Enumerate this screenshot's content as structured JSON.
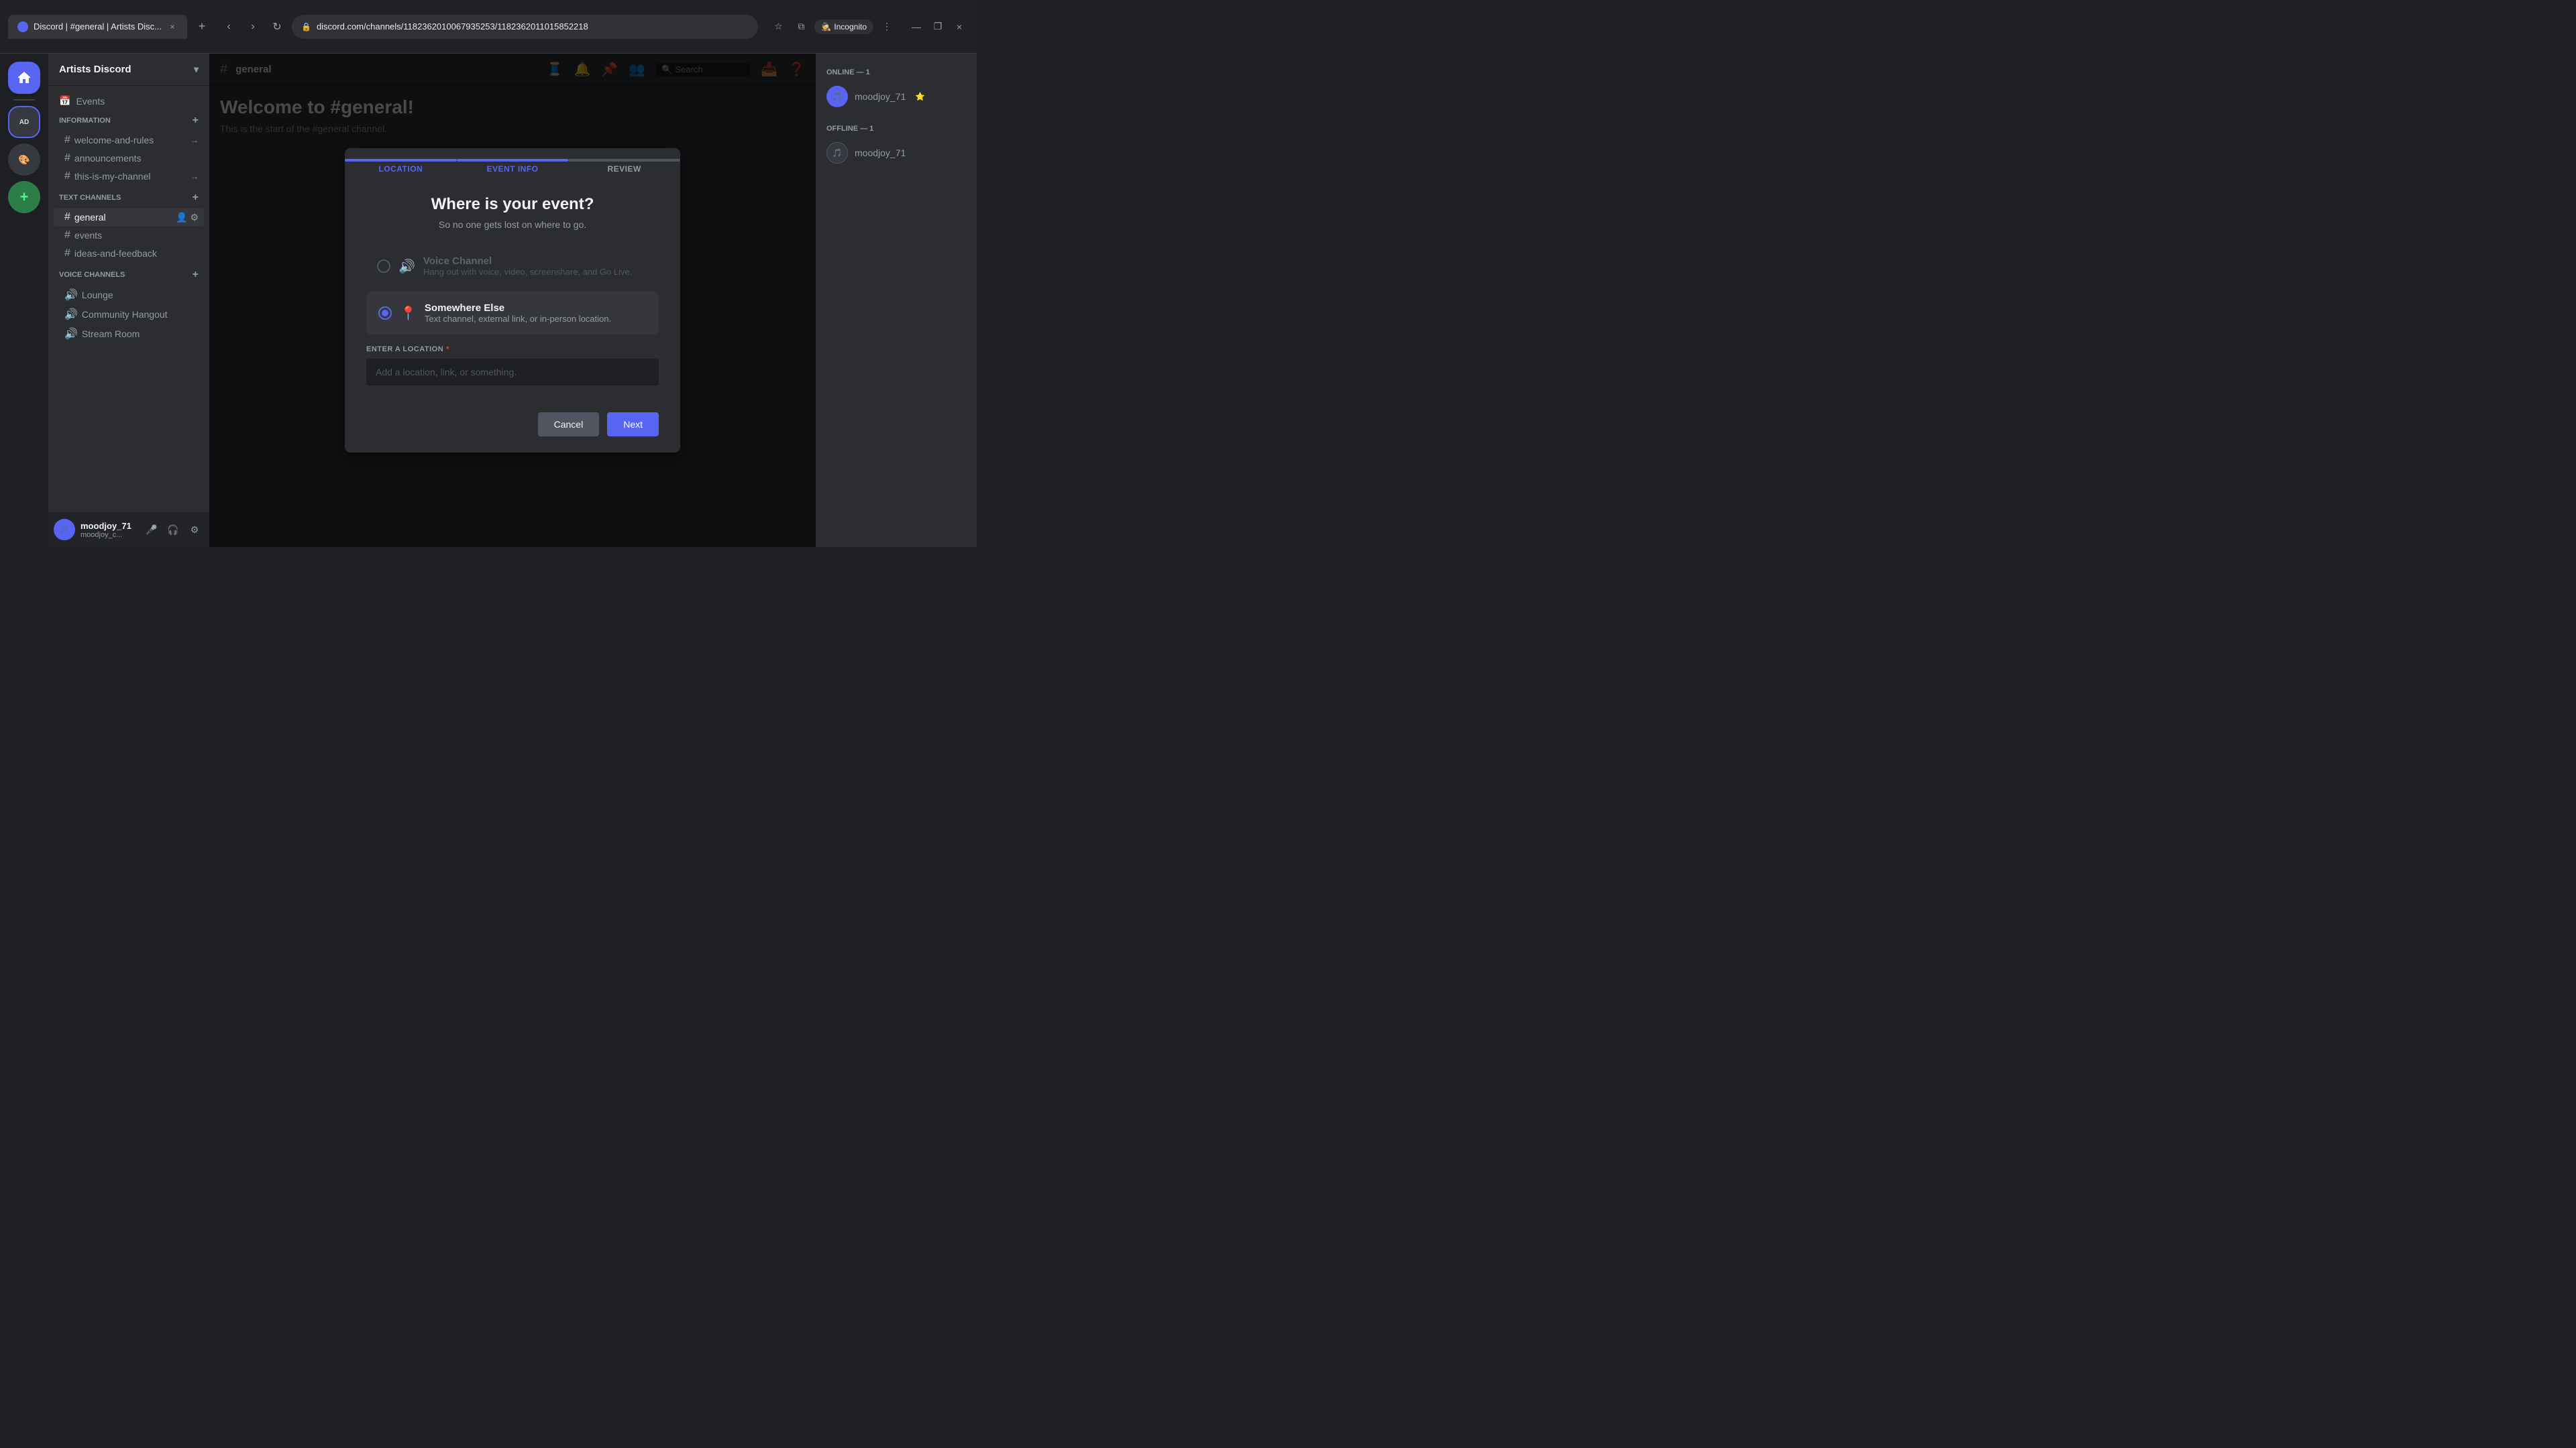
{
  "browser": {
    "tab_title": "Discord | #general | Artists Disc...",
    "tab_close": "×",
    "tab_add": "+",
    "url": "discord.com/channels/1182362010067935253/1182362011015852218",
    "incognito_label": "Incognito",
    "nav_back": "‹",
    "nav_forward": "›",
    "nav_refresh": "↻",
    "window_minimize": "—",
    "window_maximize": "❐",
    "window_close": "×"
  },
  "discord": {
    "server_name": "Artists Discord",
    "channel_header": "general",
    "welcome_title": "Welcome to #general!",
    "welcome_sub": "This is the start of the #general channel.",
    "search_placeholder": "Search"
  },
  "sidebar": {
    "events_label": "Events",
    "categories": [
      {
        "name": "INFORMATION",
        "channels": [
          {
            "name": "welcome-and-rules",
            "type": "text"
          },
          {
            "name": "announcements",
            "type": "text"
          },
          {
            "name": "this-is-my-channel",
            "type": "text"
          }
        ]
      },
      {
        "name": "TEXT CHANNELS",
        "channels": [
          {
            "name": "general",
            "type": "text",
            "active": true
          },
          {
            "name": "events",
            "type": "text"
          },
          {
            "name": "ideas-and-feedback",
            "type": "text"
          }
        ]
      },
      {
        "name": "VOICE CHANNELS",
        "channels": [
          {
            "name": "Lounge",
            "type": "voice"
          },
          {
            "name": "Community Hangout",
            "type": "voice"
          },
          {
            "name": "Stream Room",
            "type": "voice"
          }
        ]
      }
    ]
  },
  "user_panel": {
    "username": "moodjoy_71",
    "tag": "moodjoy_c..."
  },
  "members": {
    "online_label": "ONLINE — 1",
    "offline_label": "OFFLINE — 1",
    "online": [
      {
        "name": "moodjoy_71",
        "badge": "⭐",
        "color": "#5865f2"
      }
    ],
    "offline": [
      {
        "name": "moodjoy_71",
        "color": "#36393f"
      }
    ]
  },
  "modal": {
    "steps": [
      {
        "label": "Location",
        "state": "active"
      },
      {
        "label": "Event Info",
        "state": "active"
      },
      {
        "label": "Review",
        "state": "inactive"
      }
    ],
    "title": "Where is your event?",
    "subtitle": "So no one gets lost on where to go.",
    "options": [
      {
        "id": "voice",
        "label": "Voice Channel",
        "description": "Hang out with voice, video, screenshare, and Go Live.",
        "selected": false,
        "icon": "🔊"
      },
      {
        "id": "somewhere_else",
        "label": "Somewhere Else",
        "description": "Text channel, external link, or in-person location.",
        "selected": true,
        "icon": "📍"
      }
    ],
    "location_label": "ENTER A LOCATION",
    "location_placeholder": "Add a location, link, or something.",
    "cancel_label": "Cancel",
    "next_label": "Next"
  }
}
